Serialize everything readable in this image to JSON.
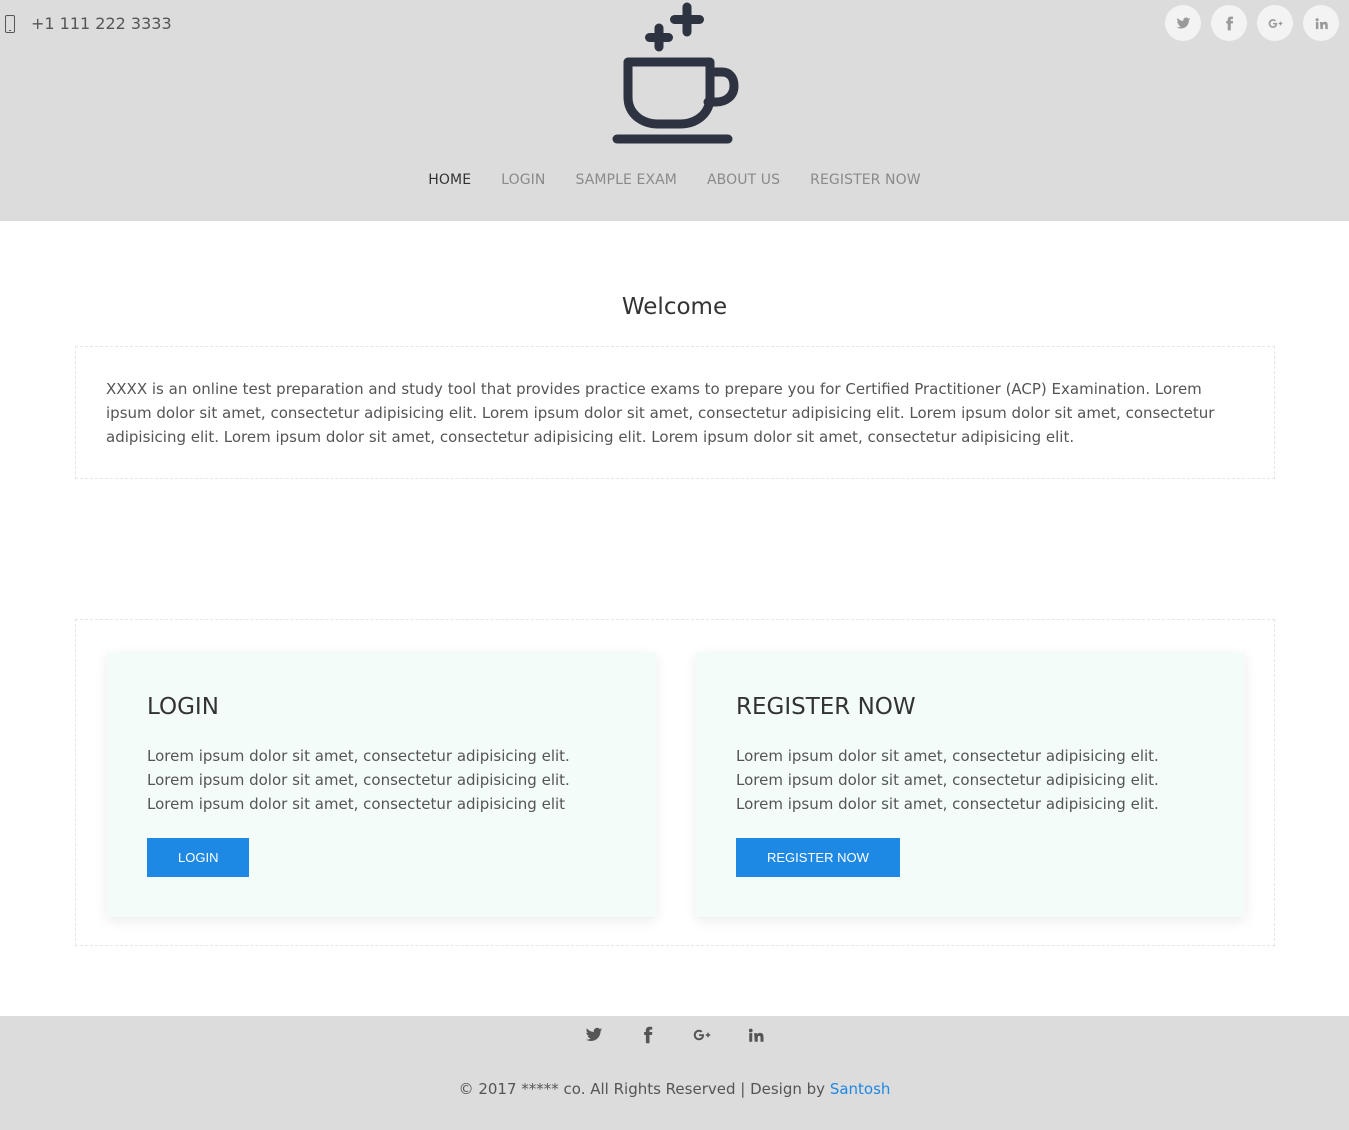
{
  "header": {
    "phone": "+1 111 222 3333",
    "social": [
      "twitter-icon",
      "facebook-icon",
      "google-plus-icon",
      "linkedin-icon"
    ],
    "nav": [
      {
        "label": "HOME",
        "active": true
      },
      {
        "label": "LOGIN",
        "active": false
      },
      {
        "label": "SAMPLE EXAM",
        "active": false
      },
      {
        "label": "ABOUT US",
        "active": false
      },
      {
        "label": "REGISTER NOW",
        "active": false
      }
    ],
    "logo_color": "#2d3340"
  },
  "welcome": {
    "title": "Welcome",
    "text": "XXXX is an online test preparation and study tool that provides practice exams to prepare you for Certified Practitioner (ACP) Examination. Lorem ipsum dolor sit amet, consectetur adipisicing elit. Lorem ipsum dolor sit amet, consectetur adipisicing elit. Lorem ipsum dolor sit amet, consectetur adipisicing elit. Lorem ipsum dolor sit amet, consectetur adipisicing elit. Lorem ipsum dolor sit amet, consectetur adipisicing elit."
  },
  "cards": {
    "login": {
      "title": "LOGIN",
      "text": "Lorem ipsum dolor sit amet, consectetur adipisicing elit. Lorem ipsum dolor sit amet, consectetur adipisicing elit. Lorem ipsum dolor sit amet, consectetur adipisicing elit",
      "button": "LOGIN"
    },
    "register": {
      "title": "REGISTER NOW",
      "text": "Lorem ipsum dolor sit amet, consectetur adipisicing elit. Lorem ipsum dolor sit amet, consectetur adipisicing elit. Lorem ipsum dolor sit amet, consectetur adipisicing elit.",
      "button": "REGISTER NOW"
    }
  },
  "footer": {
    "social": [
      "twitter-icon",
      "facebook-icon",
      "google-plus-icon",
      "linkedin-icon"
    ],
    "copyright_prefix": "© 2017 ***** co. All Rights Reserved | Design by ",
    "designer": "Santosh",
    "link_color": "#1e88e5"
  },
  "colors": {
    "header_bg": "#dcdcdc",
    "card_bg": "#f3fcf8",
    "button_bg": "#1e88e5"
  }
}
